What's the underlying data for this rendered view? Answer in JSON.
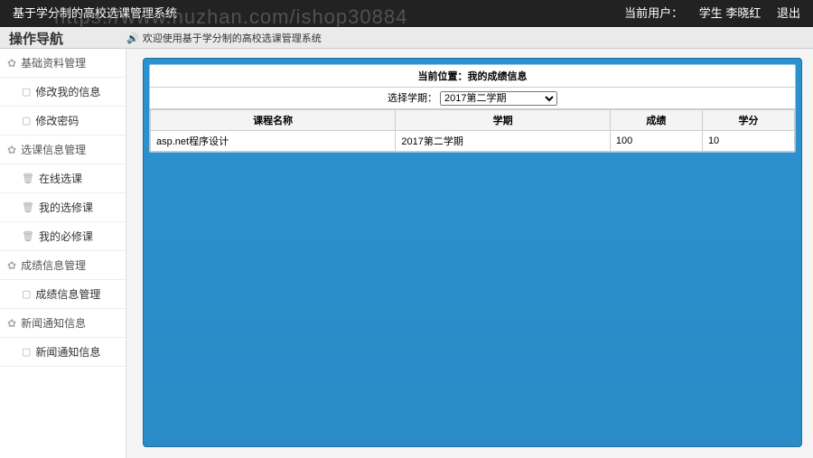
{
  "watermark": "https://www.huzhan.com/ishop30884",
  "topbar": {
    "app_title": "基于学分制的高校选课管理系统",
    "current_user_label": "当前用户：",
    "current_user_value": "学生 李晓红",
    "logout": "退出"
  },
  "subbar": {
    "nav_title": "操作导航",
    "welcome": "欢迎使用基于学分制的高校选课管理系统"
  },
  "sidebar": {
    "groups": [
      {
        "label": "基础资料管理",
        "icon": "gear",
        "items": [
          {
            "label": "修改我的信息",
            "icon": "file"
          },
          {
            "label": "修改密码",
            "icon": "file"
          }
        ]
      },
      {
        "label": "选课信息管理",
        "icon": "gear",
        "items": [
          {
            "label": "在线选课",
            "icon": "trash"
          },
          {
            "label": "我的选修课",
            "icon": "trash"
          },
          {
            "label": "我的必修课",
            "icon": "trash"
          }
        ]
      },
      {
        "label": "成绩信息管理",
        "icon": "gear",
        "items": [
          {
            "label": "成绩信息管理",
            "icon": "file"
          }
        ]
      },
      {
        "label": "新闻通知信息",
        "icon": "gear",
        "items": [
          {
            "label": "新闻通知信息",
            "icon": "file"
          }
        ]
      }
    ]
  },
  "main": {
    "location_label": "当前位置：",
    "location_value": "我的成绩信息",
    "term_label": "选择学期：",
    "term_selected": "2017第二学期",
    "columns": [
      "课程名称",
      "学期",
      "成绩",
      "学分"
    ],
    "rows": [
      {
        "course": "asp.net程序设计",
        "term": "2017第二学期",
        "score": "100",
        "credit": "10"
      }
    ]
  }
}
